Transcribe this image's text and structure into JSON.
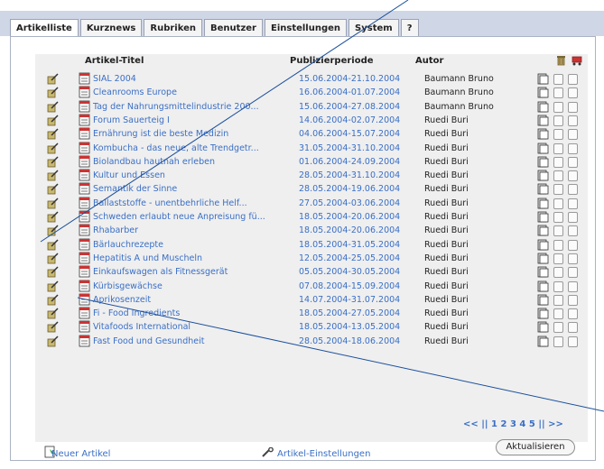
{
  "tabs": [
    "Artikelliste",
    "Kurznews",
    "Rubriken",
    "Benutzer",
    "Einstellungen",
    "System",
    "?"
  ],
  "table": {
    "headers": {
      "title": "Artikel-Titel",
      "period": "Publizierperiode",
      "author": "Autor"
    },
    "rows": [
      {
        "title": "SIAL 2004",
        "period": "15.06.2004-21.10.2004",
        "author": "Baumann Bruno"
      },
      {
        "title": "Cleanrooms Europe",
        "period": "16.06.2004-01.07.2004",
        "author": "Baumann Bruno"
      },
      {
        "title": "Tag der Nahrungsmittelindustrie 200...",
        "period": "15.06.2004-27.08.2004",
        "author": "Baumann Bruno"
      },
      {
        "title": "Forum Sauerteig I",
        "period": "14.06.2004-02.07.2004",
        "author": "Ruedi Buri"
      },
      {
        "title": "Ernährung ist die beste Medizin",
        "period": "04.06.2004-15.07.2004",
        "author": "Ruedi Buri"
      },
      {
        "title": "Kombucha - das neue, alte Trendgetr...",
        "period": "31.05.2004-31.10.2004",
        "author": "Ruedi Buri"
      },
      {
        "title": "Biolandbau hautnah erleben",
        "period": "01.06.2004-24.09.2004",
        "author": "Ruedi Buri"
      },
      {
        "title": "Kultur und Essen",
        "period": "28.05.2004-31.10.2004",
        "author": "Ruedi Buri"
      },
      {
        "title": "Semantik der Sinne",
        "period": "28.05.2004-19.06.2004",
        "author": "Ruedi Buri"
      },
      {
        "title": "Ballaststoffe - unentbehrliche Helf...",
        "period": "27.05.2004-03.06.2004",
        "author": "Ruedi Buri"
      },
      {
        "title": "Schweden erlaubt neue Anpreisung fü...",
        "period": "18.05.2004-20.06.2004",
        "author": "Ruedi Buri"
      },
      {
        "title": "Rhabarber",
        "period": "18.05.2004-20.06.2004",
        "author": "Ruedi Buri"
      },
      {
        "title": "Bärlauchrezepte",
        "period": "18.05.2004-31.05.2004",
        "author": "Ruedi Buri"
      },
      {
        "title": "Hepatitis A und Muscheln",
        "period": "12.05.2004-25.05.2004",
        "author": "Ruedi Buri"
      },
      {
        "title": "Einkaufswagen als Fitnessgerät",
        "period": "05.05.2004-30.05.2004",
        "author": "Ruedi Buri"
      },
      {
        "title": "Kürbisgewächse",
        "period": "07.08.2004-15.09.2004",
        "author": "Ruedi Buri"
      },
      {
        "title": "Aprikosenzeit",
        "period": "14.07.2004-31.07.2004",
        "author": "Ruedi Buri"
      },
      {
        "title": "Fi - Food Ingredients",
        "period": "18.05.2004-27.05.2004",
        "author": "Ruedi Buri"
      },
      {
        "title": "Vitafoods International",
        "period": "18.05.2004-13.05.2004",
        "author": "Ruedi Buri"
      },
      {
        "title": "Fast Food und Gesundheit",
        "period": "28.05.2004-18.06.2004",
        "author": "Ruedi Buri"
      }
    ]
  },
  "pagination": {
    "prev": "<<",
    "sep": "||",
    "pages": [
      "1",
      "2",
      "3",
      "4",
      "5"
    ],
    "next": ">>"
  },
  "update_button": "Aktualisieren",
  "new_article": "Neuer Artikel",
  "article_settings": "Artikel-Einstellungen",
  "colors": {
    "link": "#3a6fc6",
    "band": "#cfd6e6",
    "row_bg": "#efefef",
    "annotation_line": "#1b4f9c"
  },
  "icons": [
    "edit-icon",
    "document-icon",
    "sheets-icon",
    "trash-icon",
    "wagon-icon",
    "new-document-icon",
    "wrench-icon"
  ]
}
